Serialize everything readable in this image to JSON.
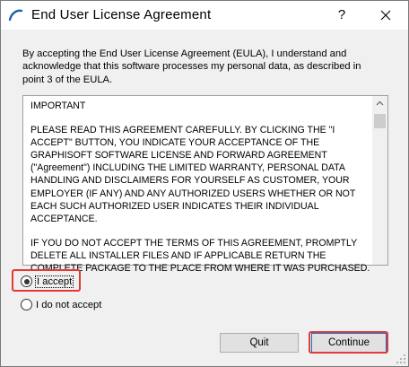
{
  "window": {
    "title": "End User License Agreement",
    "help_label": "?",
    "close_icon": "close-icon",
    "app_icon": "graphisoft-arc-icon"
  },
  "intro_text": "By accepting the End User License Agreement (EULA), I understand and acknowledge that this software processes my personal data, as described in point 3 of the EULA.",
  "eula": {
    "heading": "IMPORTANT",
    "paragraph1": "PLEASE READ THIS AGREEMENT CAREFULLY. BY CLICKING THE \"I ACCEPT\" BUTTON, YOU INDICATE YOUR ACCEPTANCE OF THE GRAPHISOFT SOFTWARE LICENSE AND FORWARD AGREEMENT (\"Agreement\") INCLUDING THE LIMITED WARRANTY, PERSONAL DATA HANDLING AND DISCLAIMERS FOR YOURSELF AS CUSTOMER, YOUR EMPLOYER (IF ANY) AND ANY AUTHORIZED USERS WHETHER OR NOT EACH SUCH AUTHORIZED USER INDICATES THEIR INDIVIDUAL ACCEPTANCE.",
    "paragraph2": "IF YOU DO NOT ACCEPT THE TERMS OF THIS AGREEMENT, PROMPTLY DELETE ALL INSTALLER FILES AND IF APPLICABLE RETURN THE COMPLETE PACKAGE TO THE PLACE FROM WHERE IT WAS PURCHASED."
  },
  "options": {
    "accept_label": "I accept",
    "decline_label": "I do not accept",
    "selected": "accept"
  },
  "buttons": {
    "quit_label": "Quit",
    "continue_label": "Continue"
  },
  "colors": {
    "highlight": "#e53935",
    "default_button_border": "#0078d7",
    "app_icon": "#1f5fa8"
  }
}
